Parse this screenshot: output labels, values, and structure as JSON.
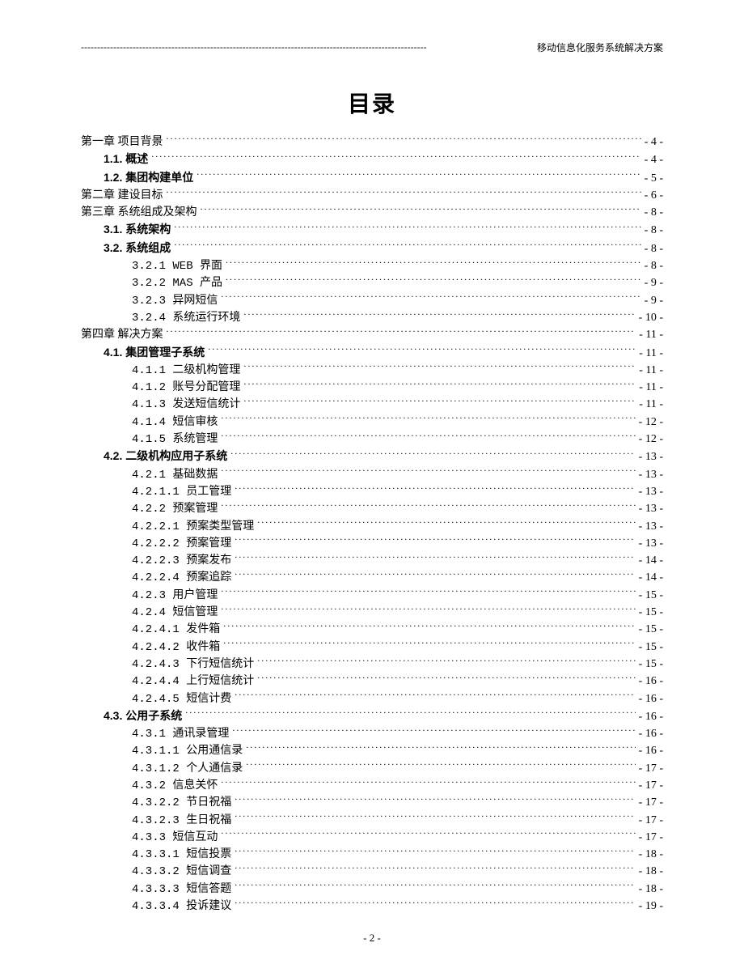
{
  "header": {
    "text": "移动信息化服务系统解决方案"
  },
  "title": "目录",
  "footer": "- 2 -",
  "toc": [
    {
      "label": "第一章  项目背景",
      "page": "- 4 -",
      "indent": 0,
      "style": "serif-bold"
    },
    {
      "label": "1.1.  概述",
      "page": "- 4 -",
      "indent": 1,
      "style": "section-bold"
    },
    {
      "label": "1.2.  集团构建单位",
      "page": "- 5 -",
      "indent": 1,
      "style": "section-bold"
    },
    {
      "label": "第二章  建设目标",
      "page": "- 6 -",
      "indent": 0,
      "style": "serif-bold"
    },
    {
      "label": "第三章  系统组成及架构",
      "page": "- 8 -",
      "indent": 0,
      "style": "serif-bold"
    },
    {
      "label": "3.1.  系统架构",
      "page": "- 8 -",
      "indent": 1,
      "style": "section-bold"
    },
    {
      "label": "3.2.  系统组成",
      "page": "- 8 -",
      "indent": 1,
      "style": "section-bold"
    },
    {
      "label": "3.2.1 WEB 界面",
      "page": "- 8 -",
      "indent": 2,
      "style": "num-mono"
    },
    {
      "label": "3.2.2 MAS 产品",
      "page": "- 9 -",
      "indent": 2,
      "style": "num-mono"
    },
    {
      "label": "3.2.3 异网短信",
      "page": "- 9 -",
      "indent": 2,
      "style": "num-mono"
    },
    {
      "label": "3.2.4 系统运行环境",
      "page": "- 10 -",
      "indent": 2,
      "style": "num-mono"
    },
    {
      "label": "第四章  解决方案",
      "page": "- 11 -",
      "indent": 0,
      "style": "serif-bold"
    },
    {
      "label": "4.1.  集团管理子系统",
      "page": "- 11 -",
      "indent": 1,
      "style": "section-bold"
    },
    {
      "label": "4.1.1 二级机构管理",
      "page": "- 11 -",
      "indent": 2,
      "style": "num-mono"
    },
    {
      "label": "4.1.2 账号分配管理",
      "page": "- 11 -",
      "indent": 2,
      "style": "num-mono"
    },
    {
      "label": "4.1.3 发送短信统计",
      "page": "- 11 -",
      "indent": 2,
      "style": "num-mono"
    },
    {
      "label": "4.1.4 短信审核",
      "page": "- 12 -",
      "indent": 2,
      "style": "num-mono"
    },
    {
      "label": "4.1.5 系统管理",
      "page": "- 12 -",
      "indent": 2,
      "style": "num-mono"
    },
    {
      "label": "4.2.  二级机构应用子系统",
      "page": "- 13 -",
      "indent": 1,
      "style": "section-bold"
    },
    {
      "label": "4.2.1 基础数据",
      "page": "- 13 -",
      "indent": 2,
      "style": "num-mono"
    },
    {
      "label": "4.2.1.1 员工管理",
      "page": "- 13 -",
      "indent": 2,
      "style": "num-mono"
    },
    {
      "label": "4.2.2 预案管理",
      "page": "- 13 -",
      "indent": 2,
      "style": "num-mono"
    },
    {
      "label": "4.2.2.1 预案类型管理",
      "page": "- 13 -",
      "indent": 2,
      "style": "num-mono"
    },
    {
      "label": "4.2.2.2 预案管理",
      "page": "- 13 -",
      "indent": 2,
      "style": "num-mono"
    },
    {
      "label": "4.2.2.3 预案发布",
      "page": "- 14 -",
      "indent": 2,
      "style": "num-mono"
    },
    {
      "label": "4.2.2.4 预案追踪",
      "page": "- 14 -",
      "indent": 2,
      "style": "num-mono"
    },
    {
      "label": "4.2.3 用户管理",
      "page": "- 15 -",
      "indent": 2,
      "style": "num-mono"
    },
    {
      "label": "4.2.4   短信管理",
      "page": "- 15 -",
      "indent": 2,
      "style": "num-mono"
    },
    {
      "label": "4.2.4.1 发件箱",
      "page": "- 15 -",
      "indent": 2,
      "style": "num-mono"
    },
    {
      "label": "4.2.4.2 收件箱",
      "page": "- 15 -",
      "indent": 2,
      "style": "num-mono"
    },
    {
      "label": "4.2.4.3 下行短信统计",
      "page": "- 15 -",
      "indent": 2,
      "style": "num-mono"
    },
    {
      "label": "4.2.4.4 上行短信统计",
      "page": "- 16 -",
      "indent": 2,
      "style": "num-mono"
    },
    {
      "label": "4.2.4.5 短信计费",
      "page": "- 16 -",
      "indent": 2,
      "style": "num-mono"
    },
    {
      "label": "4.3.  公用子系统",
      "page": "- 16 -",
      "indent": 1,
      "style": "section-bold"
    },
    {
      "label": "4.3.1 通讯录管理",
      "page": "- 16 -",
      "indent": 2,
      "style": "num-mono"
    },
    {
      "label": "4.3.1.1 公用通信录",
      "page": "- 16 -",
      "indent": 2,
      "style": "num-mono"
    },
    {
      "label": "4.3.1.2 个人通信录",
      "page": "- 17 -",
      "indent": 2,
      "style": "num-mono"
    },
    {
      "label": "4.3.2 信息关怀",
      "page": "- 17 -",
      "indent": 2,
      "style": "num-mono"
    },
    {
      "label": "4.3.2.2 节日祝福",
      "page": "- 17 -",
      "indent": 2,
      "style": "num-mono"
    },
    {
      "label": "4.3.2.3 生日祝福",
      "page": "- 17 -",
      "indent": 2,
      "style": "num-mono"
    },
    {
      "label": "4.3.3 短信互动",
      "page": "- 17 -",
      "indent": 2,
      "style": "num-mono"
    },
    {
      "label": "4.3.3.1 短信投票",
      "page": "- 18 -",
      "indent": 2,
      "style": "num-mono"
    },
    {
      "label": "4.3.3.2 短信调查",
      "page": "- 18 -",
      "indent": 2,
      "style": "num-mono"
    },
    {
      "label": "4.3.3.3 短信答题",
      "page": "- 18 -",
      "indent": 2,
      "style": "num-mono"
    },
    {
      "label": "4.3.3.4 投诉建议",
      "page": "- 19 -",
      "indent": 2,
      "style": "num-mono"
    }
  ]
}
